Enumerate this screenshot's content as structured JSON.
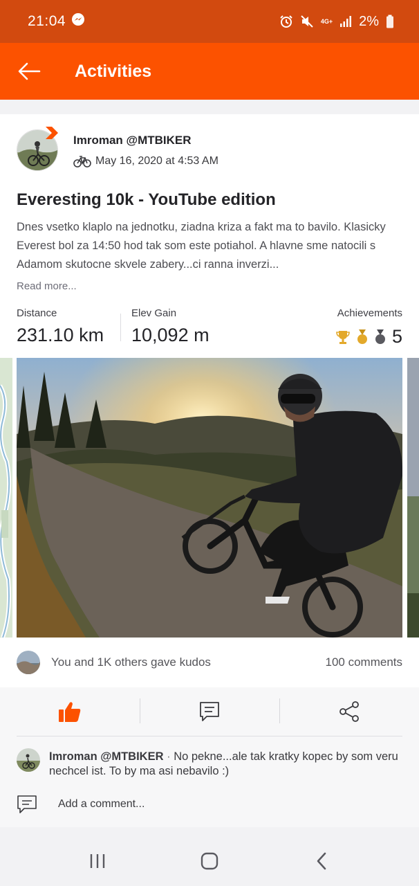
{
  "status_bar": {
    "time": "21:04",
    "network": "4G+",
    "battery": "2%"
  },
  "app_bar": {
    "title": "Activities"
  },
  "activity": {
    "athlete": "Imroman @MTBIKER",
    "date": "May 16, 2020 at 4:53 AM",
    "title": "Everesting 10k - YouTube edition",
    "description": "Dnes vsetko klaplo na jednotku, ziadna kriza a fakt ma to bavilo. Klasicky Everest bol za 14:50 hod tak som este potiahol. A hlavne sme natocili s Adamom skutocne skvele zabery...ci ranna inverzi...",
    "read_more": "Read more...",
    "stats": [
      {
        "label": "Distance",
        "value": "231.10 km"
      },
      {
        "label": "Elev Gain",
        "value": "10,092 m"
      }
    ],
    "achievements": {
      "label": "Achievements",
      "count": "5"
    }
  },
  "social": {
    "kudos": "You and 1K others gave kudos",
    "comments": "100 comments"
  },
  "comment": {
    "author": "Imroman @MTBIKER",
    "separator": " · ",
    "text": "No pekne...ale tak kratky kopec by som veru nechcel ist. To by ma asi nebavilo :)"
  },
  "add_comment": {
    "placeholder": "Add a comment..."
  },
  "colors": {
    "brand": "#fc5200",
    "status_bar": "#d24a0f",
    "kudos_orange": "#fc5200"
  },
  "icons": [
    "messenger-icon",
    "alarm-icon",
    "mute-icon",
    "signal-icon",
    "battery-icon",
    "back-arrow-icon",
    "strava-badge-icon",
    "bike-icon",
    "trophy-icon",
    "medal-gold-icon",
    "medal-bronze-icon",
    "thumbs-up-icon",
    "comment-icon",
    "share-icon",
    "recents-icon",
    "home-icon",
    "nav-back-icon"
  ]
}
